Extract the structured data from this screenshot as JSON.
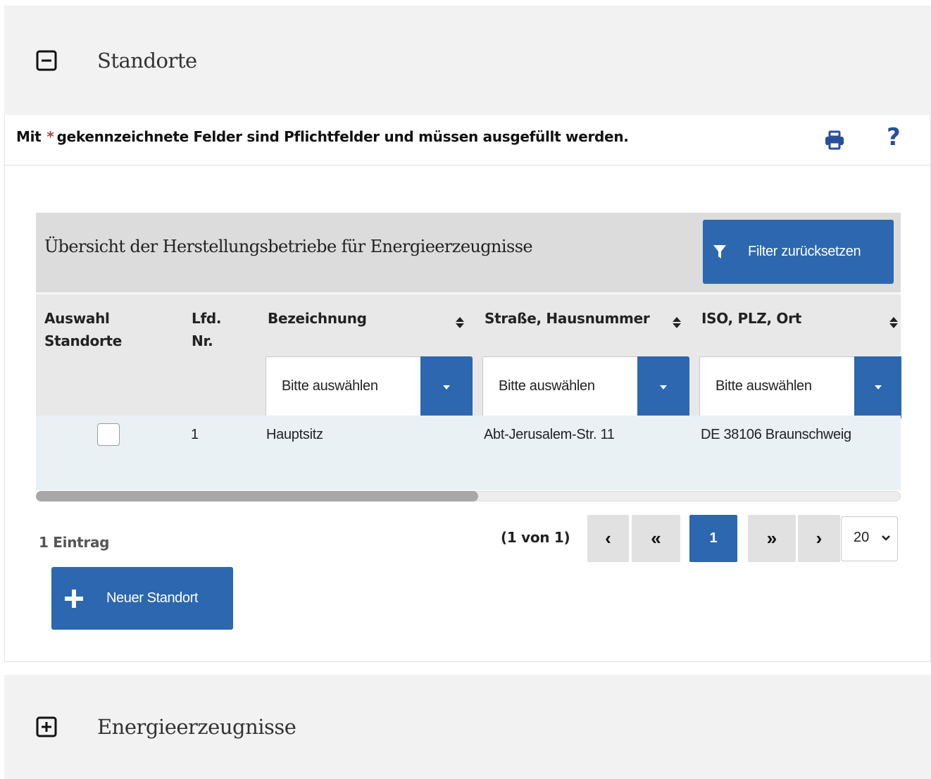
{
  "sections": {
    "standorte": {
      "title": "Standorte",
      "expanded": true
    },
    "energie": {
      "title": "Energieerzeugnisse",
      "expanded": false
    }
  },
  "notice": {
    "prefix": "Mit",
    "star": "*",
    "text": "gekennzeichnete Felder sind Pflichtfelder und müssen ausgefüllt werden."
  },
  "toolbar": {
    "print_icon": "print-icon",
    "help_label": "?"
  },
  "table": {
    "caption": "Übersicht der Herstellungsbetriebe für Energieerzeugnisse",
    "filter_reset_label": "Filter zurücksetzen",
    "columns": {
      "select": "Auswahl Standorte",
      "select_l1": "Auswahl",
      "select_l2": "Standorte",
      "lfd_l1": "Lfd.",
      "lfd_l2": "Nr.",
      "name": "Bezeichnung",
      "street": "Straße, Hausnummer",
      "place": "ISO, PLZ, Ort"
    },
    "filters": {
      "name": "Bitte auswählen",
      "street": "Bitte auswählen",
      "place": "Bitte auswählen"
    },
    "rows": [
      {
        "checked": false,
        "lfd": "1",
        "name": "Hauptsitz",
        "street": "Abt-Jerusalem-Str. 11",
        "place": "DE 38106 Braunschweig"
      }
    ]
  },
  "pagination": {
    "count_label": "1 Eintrag",
    "page_info": "(1 von 1)",
    "prev": "‹",
    "first": "«",
    "current": "1",
    "last": "»",
    "next": "›",
    "page_size": "20"
  },
  "actions": {
    "new_location_label": "Neuer Standort"
  },
  "colors": {
    "accent": "#2c67b0",
    "header_bg": "#f2f2f2",
    "row_bg": "#e9f1f5",
    "required": "#b0413e"
  }
}
